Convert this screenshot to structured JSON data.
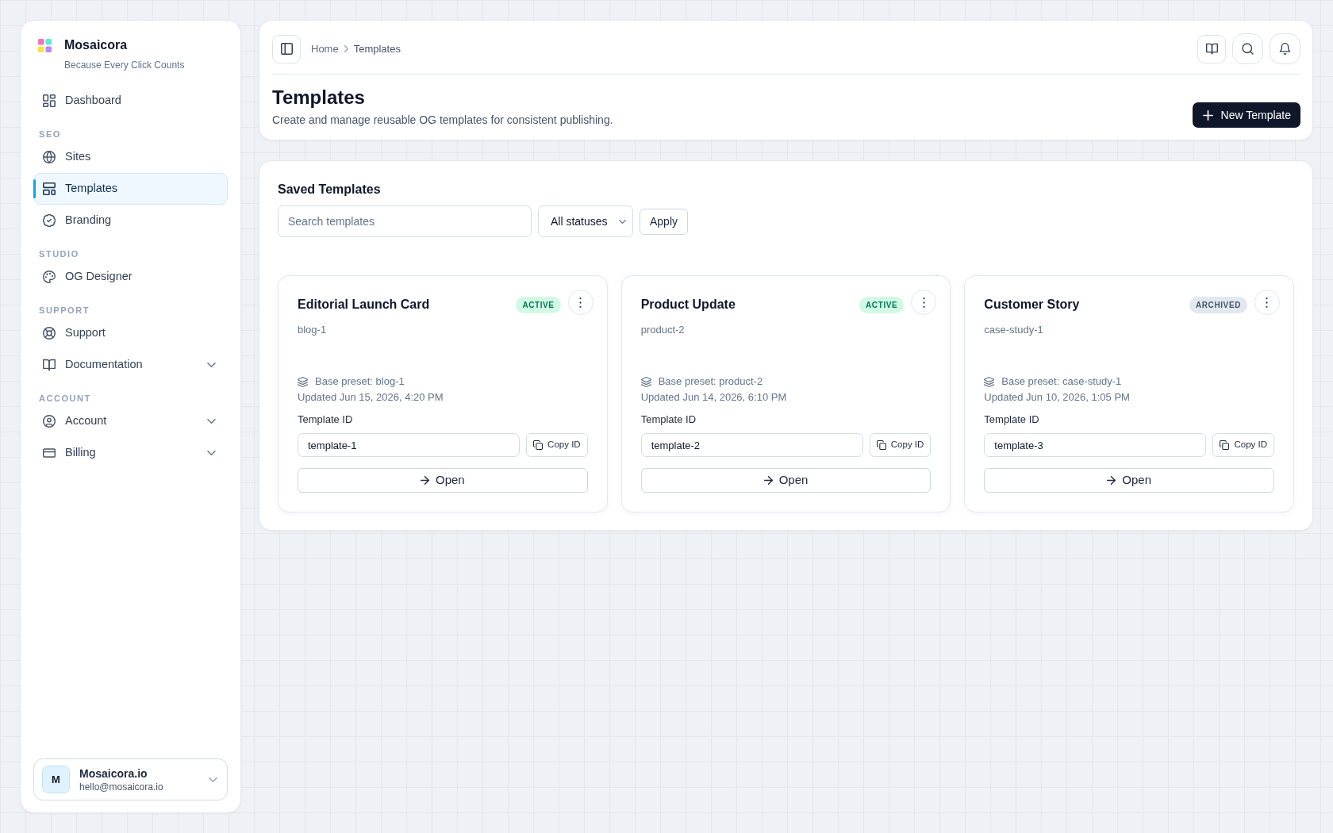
{
  "sidebar": {
    "brand": {
      "name": "Mosaicora",
      "tagline": "Because Every Click Counts"
    },
    "sections": [
      {
        "items": [
          {
            "label": "Dashboard",
            "kind": "link",
            "selected": false
          }
        ]
      },
      {
        "heading": "SEO",
        "items": [
          {
            "label": "Sites",
            "kind": "link",
            "selected": false
          },
          {
            "label": "Templates",
            "kind": "link",
            "selected": true
          },
          {
            "label": "Branding",
            "kind": "link",
            "selected": false
          }
        ]
      },
      {
        "heading": "STUDIO",
        "items": [
          {
            "label": "OG Designer",
            "kind": "link",
            "selected": false
          }
        ]
      },
      {
        "heading": "SUPPORT",
        "items": [
          {
            "label": "Support",
            "kind": "link",
            "selected": false
          },
          {
            "label": "Documentation",
            "kind": "group",
            "selected": false,
            "expanded": false
          }
        ]
      },
      {
        "heading": "ACCOUNT",
        "items": [
          {
            "label": "Account",
            "kind": "group",
            "selected": false,
            "expanded": false
          },
          {
            "label": "Billing",
            "kind": "group",
            "selected": false,
            "expanded": false
          }
        ]
      }
    ],
    "user": {
      "initial": "M",
      "name": "Mosaicora.io",
      "email": "hello@mosaicora.io"
    }
  },
  "header": {
    "breadcrumb": [
      "Home",
      "Templates"
    ],
    "title": "Templates",
    "subtitle": "Create and manage reusable OG templates for consistent publishing.",
    "new_button": "New Template"
  },
  "templates_panel": {
    "title": "Saved Templates",
    "search": {
      "placeholder": "Search templates"
    },
    "status_filter": {
      "value": "All statuses"
    },
    "apply_button": "Apply",
    "cards": [
      {
        "title": "Editorial Launch Card",
        "status": {
          "label": "ACTIVE",
          "kind": "active"
        },
        "slug": "blog-1",
        "base_preset": "Base preset: blog-1",
        "updated": "Updated Jun 15, 2026, 4:20 PM",
        "id_label": "Template ID",
        "id_value": "template-1",
        "copy_button": "Copy ID",
        "open_button": "Open"
      },
      {
        "title": "Product Update",
        "status": {
          "label": "ACTIVE",
          "kind": "active"
        },
        "slug": "product-2",
        "base_preset": "Base preset: product-2",
        "updated": "Updated Jun 14, 2026, 6:10 PM",
        "id_label": "Template ID",
        "id_value": "template-2",
        "copy_button": "Copy ID",
        "open_button": "Open"
      },
      {
        "title": "Customer Story",
        "status": {
          "label": "ARCHIVED",
          "kind": "archived"
        },
        "slug": "case-study-1",
        "base_preset": "Base preset: case-study-1",
        "updated": "Updated Jun 10, 2026, 1:05 PM",
        "id_label": "Template ID",
        "id_value": "template-3",
        "copy_button": "Copy ID",
        "open_button": "Open"
      }
    ]
  }
}
